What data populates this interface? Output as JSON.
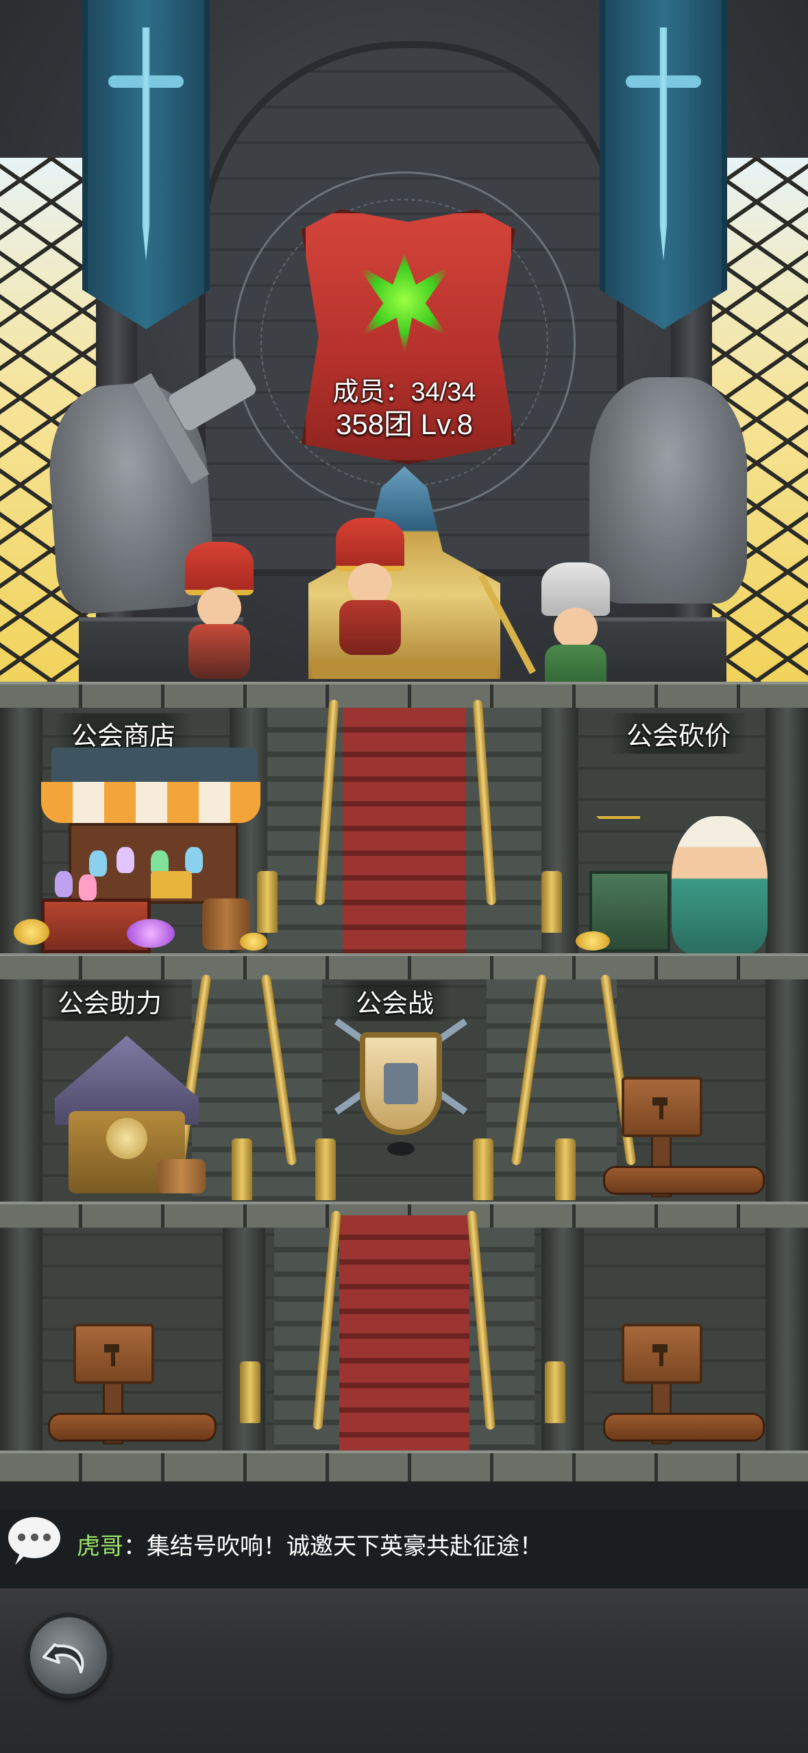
{
  "guild": {
    "members_text": "成员：34/34",
    "level_text": "358团 Lv.8"
  },
  "rooms": {
    "shop_label": "公会商店",
    "bargain_label": "公会砍价",
    "assist_label": "公会助力",
    "war_label": "公会战"
  },
  "chat": {
    "sender": "虎哥",
    "separator": "：",
    "message": "集结号吹响！诚邀天下英豪共赴征途！"
  },
  "icons": {
    "chat": "speech-bubble-icon",
    "back": "undo-arrow-icon",
    "locked_room": "hammer-signpost-icon"
  },
  "colors": {
    "chat_sender": "#9be26b",
    "emblem_red": "#c23a31",
    "emblem_glyph": "#5fe22a"
  }
}
